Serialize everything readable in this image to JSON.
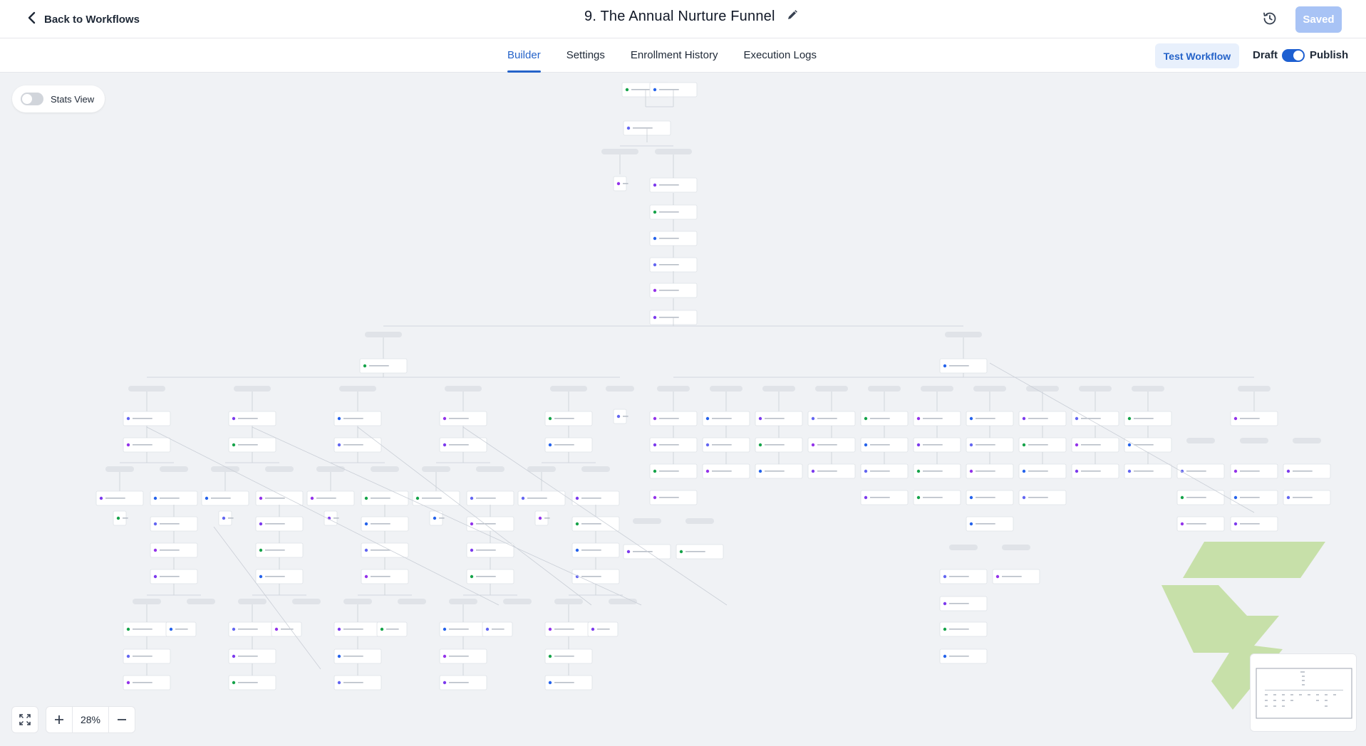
{
  "header": {
    "back_label": "Back to Workflows",
    "title": "9. The Annual Nurture Funnel",
    "saved_label": "Saved"
  },
  "tabs": [
    {
      "label": "Builder",
      "active": true
    },
    {
      "label": "Settings",
      "active": false
    },
    {
      "label": "Enrollment History",
      "active": false
    },
    {
      "label": "Execution Logs",
      "active": false
    }
  ],
  "actions": {
    "test_label": "Test Workflow",
    "draft_label": "Draft",
    "publish_label": "Publish",
    "published": true
  },
  "canvas": {
    "stats_label": "Stats View",
    "stats_on": false,
    "zoom": "28%"
  },
  "colors": {
    "accent": "#2563c9",
    "saved_bg": "#a8c3f5",
    "canvas_bg": "#f0f2f5",
    "watermark": "#b9d98f"
  },
  "icons": {
    "back": "chevron-left-icon",
    "edit": "pencil-icon",
    "history": "history-icon",
    "fit": "fit-screen-icon",
    "zoom_in": "plus-icon",
    "zoom_out": "minus-icon"
  }
}
